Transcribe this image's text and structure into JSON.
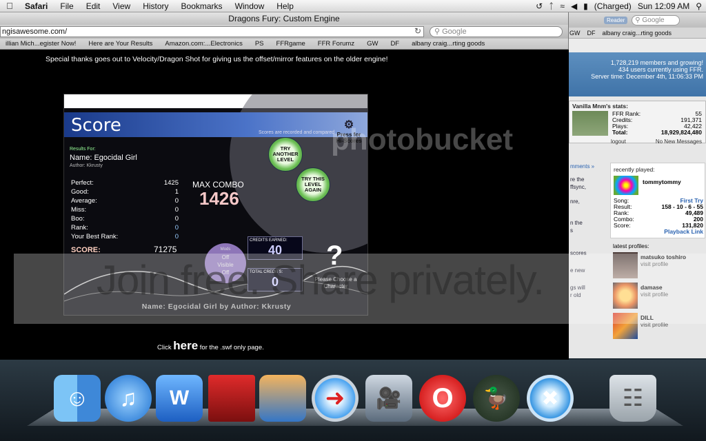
{
  "menubar": {
    "app": "Safari",
    "items": [
      "File",
      "Edit",
      "View",
      "History",
      "Bookmarks",
      "Window",
      "Help"
    ],
    "battery": "(Charged)",
    "clock": "Sun 12:09 AM"
  },
  "window": {
    "title": "Dragons Fury: Custom Engine",
    "url": "ngisawesome.com/",
    "search_placeholder": "Google",
    "bookmarks": [
      "illian Mich...egister Now!",
      "Here are Your Results",
      "Amazon.com:...Electronics",
      "PS",
      "FFRgame",
      "FFR Forumz",
      "GW",
      "DF",
      "albany craig...rting goods"
    ]
  },
  "page": {
    "thanks": "Special thanks goes out to Velocity/Dragon Shot for giving us the offset/mirror features on the older engine!",
    "footer_pre": "Click",
    "footer_link": "here",
    "footer_post": "for the .swf only page."
  },
  "game": {
    "title": "Score",
    "hiscore": "Press for Hi-Scores",
    "recorded": "Scores are recorded and compared",
    "results_for": "Results For:",
    "name": "Name: Egocidal Girl",
    "author": "Author: Kkrusty",
    "results": [
      {
        "label": "Perfect:",
        "value": "1425"
      },
      {
        "label": "Good:",
        "value": "1"
      },
      {
        "label": "Average:",
        "value": "0"
      },
      {
        "label": "Miss:",
        "value": "0"
      },
      {
        "label": "Boo:",
        "value": "0"
      },
      {
        "label": "Rank:",
        "value": "0"
      },
      {
        "label": "Your Best Rank:",
        "value": "0"
      }
    ],
    "max_combo_label": "MAX COMBO",
    "max_combo": "1426",
    "score_label": "SCORE:",
    "score": "71275",
    "try_another": "TRY ANOTHER LEVEL",
    "try_again": "TRY THIS LEVEL AGAIN",
    "mods_label": "Mods",
    "mods_off": "Off",
    "mods_visible": "Visible",
    "mods_off2": "Off",
    "credits_earned_label": "CREDITS EARNED:",
    "credits_earned": "40",
    "total_credits_label": "TOTAL CREDITS:",
    "total_credits": "0",
    "choose": "Please Choose a Character",
    "bottom": "Name: Egocidal Girl by Author: Kkrusty"
  },
  "watermark": {
    "logo": "photobucket",
    "band": "Join free. Share privately."
  },
  "bgwin": {
    "reader": "Reader",
    "search_placeholder": "Google",
    "bookmarks": [
      "GW",
      "DF",
      "albany craig...rting goods"
    ],
    "header_line1": "1,728,219 members and growing!",
    "header_line2": "434 users currently using FFR.",
    "header_line3": "Server time: December 4th, 11:06:33 PM",
    "stats_title": "Vanilla Mnm's stats:",
    "stats": [
      {
        "label": "FFR Rank:",
        "value": "55"
      },
      {
        "label": "Credits:",
        "value": "191,371"
      },
      {
        "label": "Plays:",
        "value": "42,422"
      },
      {
        "label": "Total:",
        "value": "18,929,824,480"
      }
    ],
    "logout": "logout",
    "messages": "No New Messages",
    "left_text": [
      "mments »",
      "re the",
      "ffsync,",
      "nre,",
      "n the",
      "s",
      "scores",
      "e new",
      "gs will",
      "r old"
    ],
    "recent_title": "recently played:",
    "recent_user": "tommytommy",
    "recent": [
      {
        "label": "Song:",
        "value": "First Try"
      },
      {
        "label": "Result:",
        "value": "158 - 10 - 6 - 55"
      },
      {
        "label": "Rank:",
        "value": "49,489"
      },
      {
        "label": "Combo:",
        "value": "200"
      },
      {
        "label": "Score:",
        "value": "131,820"
      }
    ],
    "playback": "Playback Link",
    "latest_title": "latest profiles:",
    "profiles": [
      {
        "name": "matsuko toshiro",
        "link": "visit profile"
      },
      {
        "name": "damase",
        "link": "visit profile"
      },
      {
        "name": "DILL",
        "link": "visit profile"
      }
    ]
  },
  "dock": [
    "finder-icon",
    "itunes-icon",
    "word-icon",
    "photo-booth-icon",
    "iphoto-icon",
    "safari-icon",
    "imovie-icon",
    "opera-icon",
    "adium-icon",
    "xcode-icon",
    "trash-icon"
  ]
}
